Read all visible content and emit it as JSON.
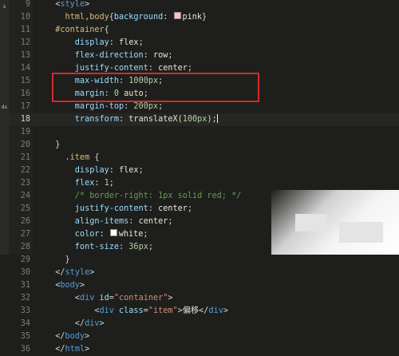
{
  "activity_bar": {
    "items": [
      "s",
      "ds"
    ]
  },
  "editor": {
    "lines": [
      {
        "n": "9",
        "tokens": [
          {
            "t": "  <",
            "c": "t-punc"
          },
          {
            "t": "style",
            "c": "t-tag"
          },
          {
            "t": ">",
            "c": "t-punc"
          }
        ]
      },
      {
        "n": "10",
        "tokens": [
          {
            "t": "    html,body",
            "c": "t-sel"
          },
          {
            "t": "{",
            "c": "t-punc"
          },
          {
            "t": "background",
            "c": "t-prop"
          },
          {
            "t": ": ",
            "c": "t-punc"
          },
          {
            "swatch": "#ffc0cb"
          },
          {
            "t": "pink",
            "c": "t-val"
          },
          {
            "t": "}",
            "c": "t-punc"
          }
        ]
      },
      {
        "n": "11",
        "tokens": [
          {
            "t": "  #container",
            "c": "t-sel"
          },
          {
            "t": "{",
            "c": "t-punc"
          }
        ]
      },
      {
        "n": "12",
        "tokens": [
          {
            "t": "      display",
            "c": "t-prop"
          },
          {
            "t": ": ",
            "c": "t-punc"
          },
          {
            "t": "flex",
            "c": "t-val"
          },
          {
            "t": ";",
            "c": "t-punc"
          }
        ]
      },
      {
        "n": "13",
        "tokens": [
          {
            "t": "      flex-direction",
            "c": "t-prop"
          },
          {
            "t": ": ",
            "c": "t-punc"
          },
          {
            "t": "row",
            "c": "t-val"
          },
          {
            "t": ";",
            "c": "t-punc"
          }
        ]
      },
      {
        "n": "14",
        "tokens": [
          {
            "t": "      justify-content",
            "c": "t-prop"
          },
          {
            "t": ": ",
            "c": "t-punc"
          },
          {
            "t": "center",
            "c": "t-val"
          },
          {
            "t": ";",
            "c": "t-punc"
          }
        ]
      },
      {
        "n": "15",
        "tokens": [
          {
            "t": "      max-width",
            "c": "t-prop"
          },
          {
            "t": ": ",
            "c": "t-punc"
          },
          {
            "t": "1000px",
            "c": "t-num"
          },
          {
            "t": ";",
            "c": "t-punc"
          }
        ]
      },
      {
        "n": "16",
        "tokens": [
          {
            "t": "      margin",
            "c": "t-prop"
          },
          {
            "t": ": ",
            "c": "t-punc"
          },
          {
            "t": "0 ",
            "c": "t-num"
          },
          {
            "t": "auto",
            "c": "t-val"
          },
          {
            "t": ";",
            "c": "t-punc"
          }
        ]
      },
      {
        "n": "17",
        "tokens": [
          {
            "t": "      margin-top",
            "c": "t-prop"
          },
          {
            "t": ": ",
            "c": "t-punc"
          },
          {
            "t": "200px",
            "c": "t-num"
          },
          {
            "t": ";",
            "c": "t-punc"
          }
        ]
      },
      {
        "n": "18",
        "active": true,
        "tokens": [
          {
            "t": "      transform",
            "c": "t-prop"
          },
          {
            "t": ": ",
            "c": "t-punc"
          },
          {
            "t": "translateX(",
            "c": "t-val"
          },
          {
            "t": "100px",
            "c": "t-num"
          },
          {
            "t": ");",
            "c": "t-punc"
          },
          {
            "cursor": true
          }
        ]
      },
      {
        "n": "19",
        "tokens": []
      },
      {
        "n": "20",
        "tokens": [
          {
            "t": "  }",
            "c": "t-punc"
          }
        ]
      },
      {
        "n": "21",
        "tokens": [
          {
            "t": "    .item ",
            "c": "t-sel"
          },
          {
            "t": "{",
            "c": "t-punc"
          }
        ]
      },
      {
        "n": "22",
        "tokens": [
          {
            "t": "      display",
            "c": "t-prop"
          },
          {
            "t": ": ",
            "c": "t-punc"
          },
          {
            "t": "flex",
            "c": "t-val"
          },
          {
            "t": ";",
            "c": "t-punc"
          }
        ]
      },
      {
        "n": "23",
        "tokens": [
          {
            "t": "      flex",
            "c": "t-prop"
          },
          {
            "t": ": ",
            "c": "t-punc"
          },
          {
            "t": "1",
            "c": "t-num"
          },
          {
            "t": ";",
            "c": "t-punc"
          }
        ]
      },
      {
        "n": "24",
        "tokens": [
          {
            "t": "      /* border-right: 1px solid red; */",
            "c": "t-cmt"
          }
        ]
      },
      {
        "n": "25",
        "tokens": [
          {
            "t": "      justify-content",
            "c": "t-prop"
          },
          {
            "t": ": ",
            "c": "t-punc"
          },
          {
            "t": "center",
            "c": "t-val"
          },
          {
            "t": ";",
            "c": "t-punc"
          }
        ]
      },
      {
        "n": "26",
        "tokens": [
          {
            "t": "      align-items",
            "c": "t-prop"
          },
          {
            "t": ": ",
            "c": "t-punc"
          },
          {
            "t": "center",
            "c": "t-val"
          },
          {
            "t": ";",
            "c": "t-punc"
          }
        ]
      },
      {
        "n": "27",
        "tokens": [
          {
            "t": "      color",
            "c": "t-prop"
          },
          {
            "t": ": ",
            "c": "t-punc"
          },
          {
            "swatch": "#ffffff"
          },
          {
            "t": "white",
            "c": "t-val"
          },
          {
            "t": ";",
            "c": "t-punc"
          }
        ]
      },
      {
        "n": "28",
        "tokens": [
          {
            "t": "      font-size",
            "c": "t-prop"
          },
          {
            "t": ": ",
            "c": "t-punc"
          },
          {
            "t": "36px",
            "c": "t-num"
          },
          {
            "t": ";",
            "c": "t-punc"
          }
        ]
      },
      {
        "n": "29",
        "tokens": [
          {
            "t": "    }",
            "c": "t-punc"
          }
        ]
      },
      {
        "n": "30",
        "tokens": [
          {
            "t": "  </",
            "c": "t-punc"
          },
          {
            "t": "style",
            "c": "t-tag"
          },
          {
            "t": ">",
            "c": "t-punc"
          }
        ]
      },
      {
        "n": "31",
        "tokens": [
          {
            "t": "  <",
            "c": "t-punc"
          },
          {
            "t": "body",
            "c": "t-tag"
          },
          {
            "t": ">",
            "c": "t-punc"
          }
        ]
      },
      {
        "n": "32",
        "tokens": [
          {
            "t": "      <",
            "c": "t-punc"
          },
          {
            "t": "div ",
            "c": "t-tag"
          },
          {
            "t": "id",
            "c": "t-prop"
          },
          {
            "t": "=",
            "c": "t-punc"
          },
          {
            "t": "\"container\"",
            "c": "t-str"
          },
          {
            "t": ">",
            "c": "t-punc"
          }
        ]
      },
      {
        "n": "33",
        "tokens": [
          {
            "t": "          <",
            "c": "t-punc"
          },
          {
            "t": "div ",
            "c": "t-tag"
          },
          {
            "t": "class",
            "c": "t-prop"
          },
          {
            "t": "=",
            "c": "t-punc"
          },
          {
            "t": "\"item\"",
            "c": "t-str"
          },
          {
            "t": ">",
            "c": "t-punc"
          },
          {
            "t": "偏移",
            "c": "t-txt"
          },
          {
            "t": "</",
            "c": "t-punc"
          },
          {
            "t": "div",
            "c": "t-tag"
          },
          {
            "t": ">",
            "c": "t-punc"
          }
        ]
      },
      {
        "n": "34",
        "tokens": [
          {
            "t": "      </",
            "c": "t-punc"
          },
          {
            "t": "div",
            "c": "t-tag"
          },
          {
            "t": ">",
            "c": "t-punc"
          }
        ]
      },
      {
        "n": "35",
        "tokens": [
          {
            "t": "  </",
            "c": "t-punc"
          },
          {
            "t": "body",
            "c": "t-tag"
          },
          {
            "t": ">",
            "c": "t-punc"
          }
        ]
      },
      {
        "n": "36",
        "tokens": [
          {
            "t": "  </",
            "c": "t-punc"
          },
          {
            "t": "html",
            "c": "t-tag"
          },
          {
            "t": ">",
            "c": "t-punc"
          }
        ]
      }
    ]
  },
  "colors": {
    "background": "#1e1f1c",
    "highlight_border": "#d42a2a",
    "tag": "#569cd6",
    "selector": "#d7ba7d",
    "property": "#9cdcfe",
    "number": "#b5cea8",
    "comment": "#6a9955",
    "string": "#ce9178"
  }
}
